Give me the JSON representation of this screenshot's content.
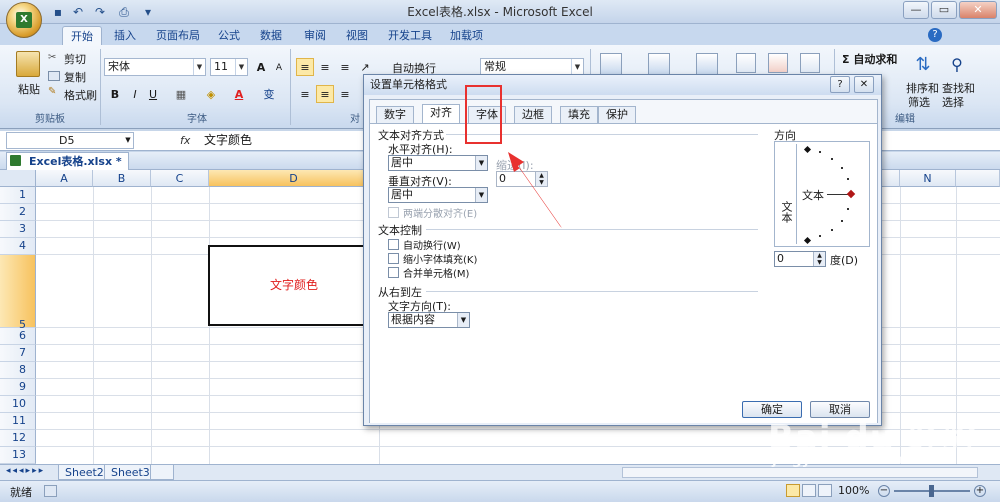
{
  "window": {
    "title": "Excel表格.xlsx - Microsoft Excel",
    "controls": {
      "minimize": "—",
      "maximize": "▭",
      "close": "✕"
    }
  },
  "office_button": {
    "logo": "X"
  },
  "ribbon": {
    "tabs": [
      "开始",
      "插入",
      "页面布局",
      "公式",
      "数据",
      "审阅",
      "视图",
      "开发工具",
      "加载项"
    ],
    "active_tab": "开始",
    "clipboard": {
      "paste": "粘贴",
      "cut": "剪切",
      "copy": "复制",
      "format_painter": "格式刷",
      "group": "剪贴板"
    },
    "font": {
      "name": "宋体",
      "size": "11",
      "grow": "A",
      "shrink": "A",
      "bold": "B",
      "italic": "I",
      "underline": "U",
      "wen": "变",
      "group": "字体"
    },
    "alignment": {
      "wrap": "自动换行",
      "group": "对"
    },
    "number": {
      "format": "常规"
    },
    "editing": {
      "autosum": "Σ 自动求和",
      "sort_filter": "排序和\n筛选",
      "sort": "排序和",
      "filter": "筛选",
      "find": "查找和",
      "select": "选择",
      "group": "编辑"
    }
  },
  "formula_bar": {
    "name_box": "D5",
    "fx": "fx",
    "content": "文字颜色"
  },
  "workbook": {
    "tab_title": "Excel表格.xlsx *"
  },
  "grid": {
    "columns": [
      "A",
      "B",
      "C",
      "D",
      "N"
    ],
    "rows": [
      "1",
      "2",
      "3",
      "4",
      "5",
      "6",
      "7",
      "8",
      "9",
      "10",
      "11",
      "12",
      "13",
      "14",
      "15"
    ],
    "cell_d5": "文字颜色",
    "cell_d5_color": "#e0201e"
  },
  "sheet_tabs": [
    "Sheet2",
    "Sheet3"
  ],
  "status": {
    "ready": "就绪",
    "zoom": "100%"
  },
  "dialog": {
    "title": "设置单元格格式",
    "help": "?",
    "close": "✕",
    "tabs": [
      "数字",
      "对齐",
      "字体",
      "边框",
      "填充",
      "保护"
    ],
    "selected_tab": "对齐",
    "text_align_section": "文本对齐方式",
    "horizontal_label": "水平对齐(H):",
    "horizontal_value": "居中",
    "indent_label": "缩进(I):",
    "indent_value": "0",
    "vertical_label": "垂直对齐(V):",
    "vertical_value": "居中",
    "distributed_label": "两端分散对齐(E)",
    "text_control_section": "文本控制",
    "wrap_label": "自动换行(W)",
    "shrink_label": "缩小字体填充(K)",
    "merge_label": "合并单元格(M)",
    "rtl_section": "从右到左",
    "direction_label": "文字方向(T):",
    "direction_value": "根据内容",
    "orientation_label": "方向",
    "orientation_vertical": "文本",
    "orientation_text": "文本",
    "degrees_value": "0",
    "degrees_label": "度(D)",
    "ok": "确定",
    "cancel": "取消"
  },
  "annotation": {
    "highlight_color": "#e8312f"
  },
  "watermark": {
    "brand": "Bai du 经验",
    "url": "jingyan.baidu.com"
  }
}
